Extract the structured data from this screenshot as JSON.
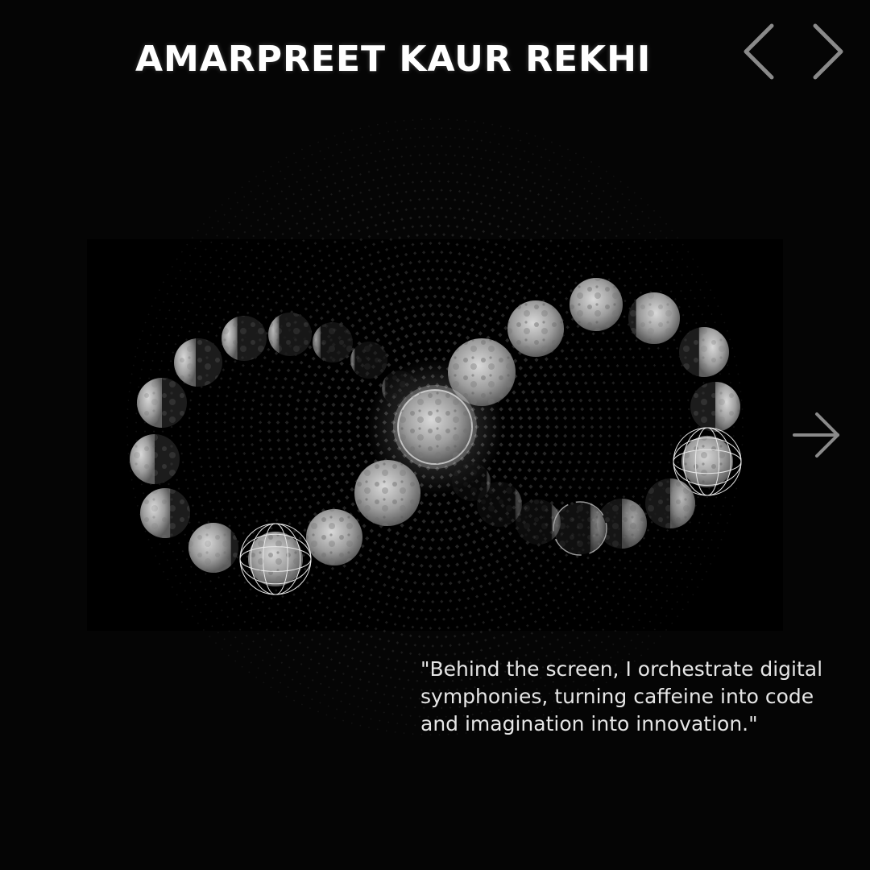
{
  "header": {
    "title": "AMARPREET KAUR REKHI"
  },
  "nav": {
    "prev_icon": "chevron-left-icon",
    "next_icon": "chevron-right-icon",
    "forward_icon": "arrow-right-icon"
  },
  "quote": {
    "text": "\"Behind the screen, I orchestrate digital symphonies, turning caffeine into code and imagination into innovation.\""
  },
  "colors": {
    "background": "#050505",
    "title": "#ffffff",
    "quote": "#e6e6e6",
    "icon": "#8a8a8a"
  }
}
